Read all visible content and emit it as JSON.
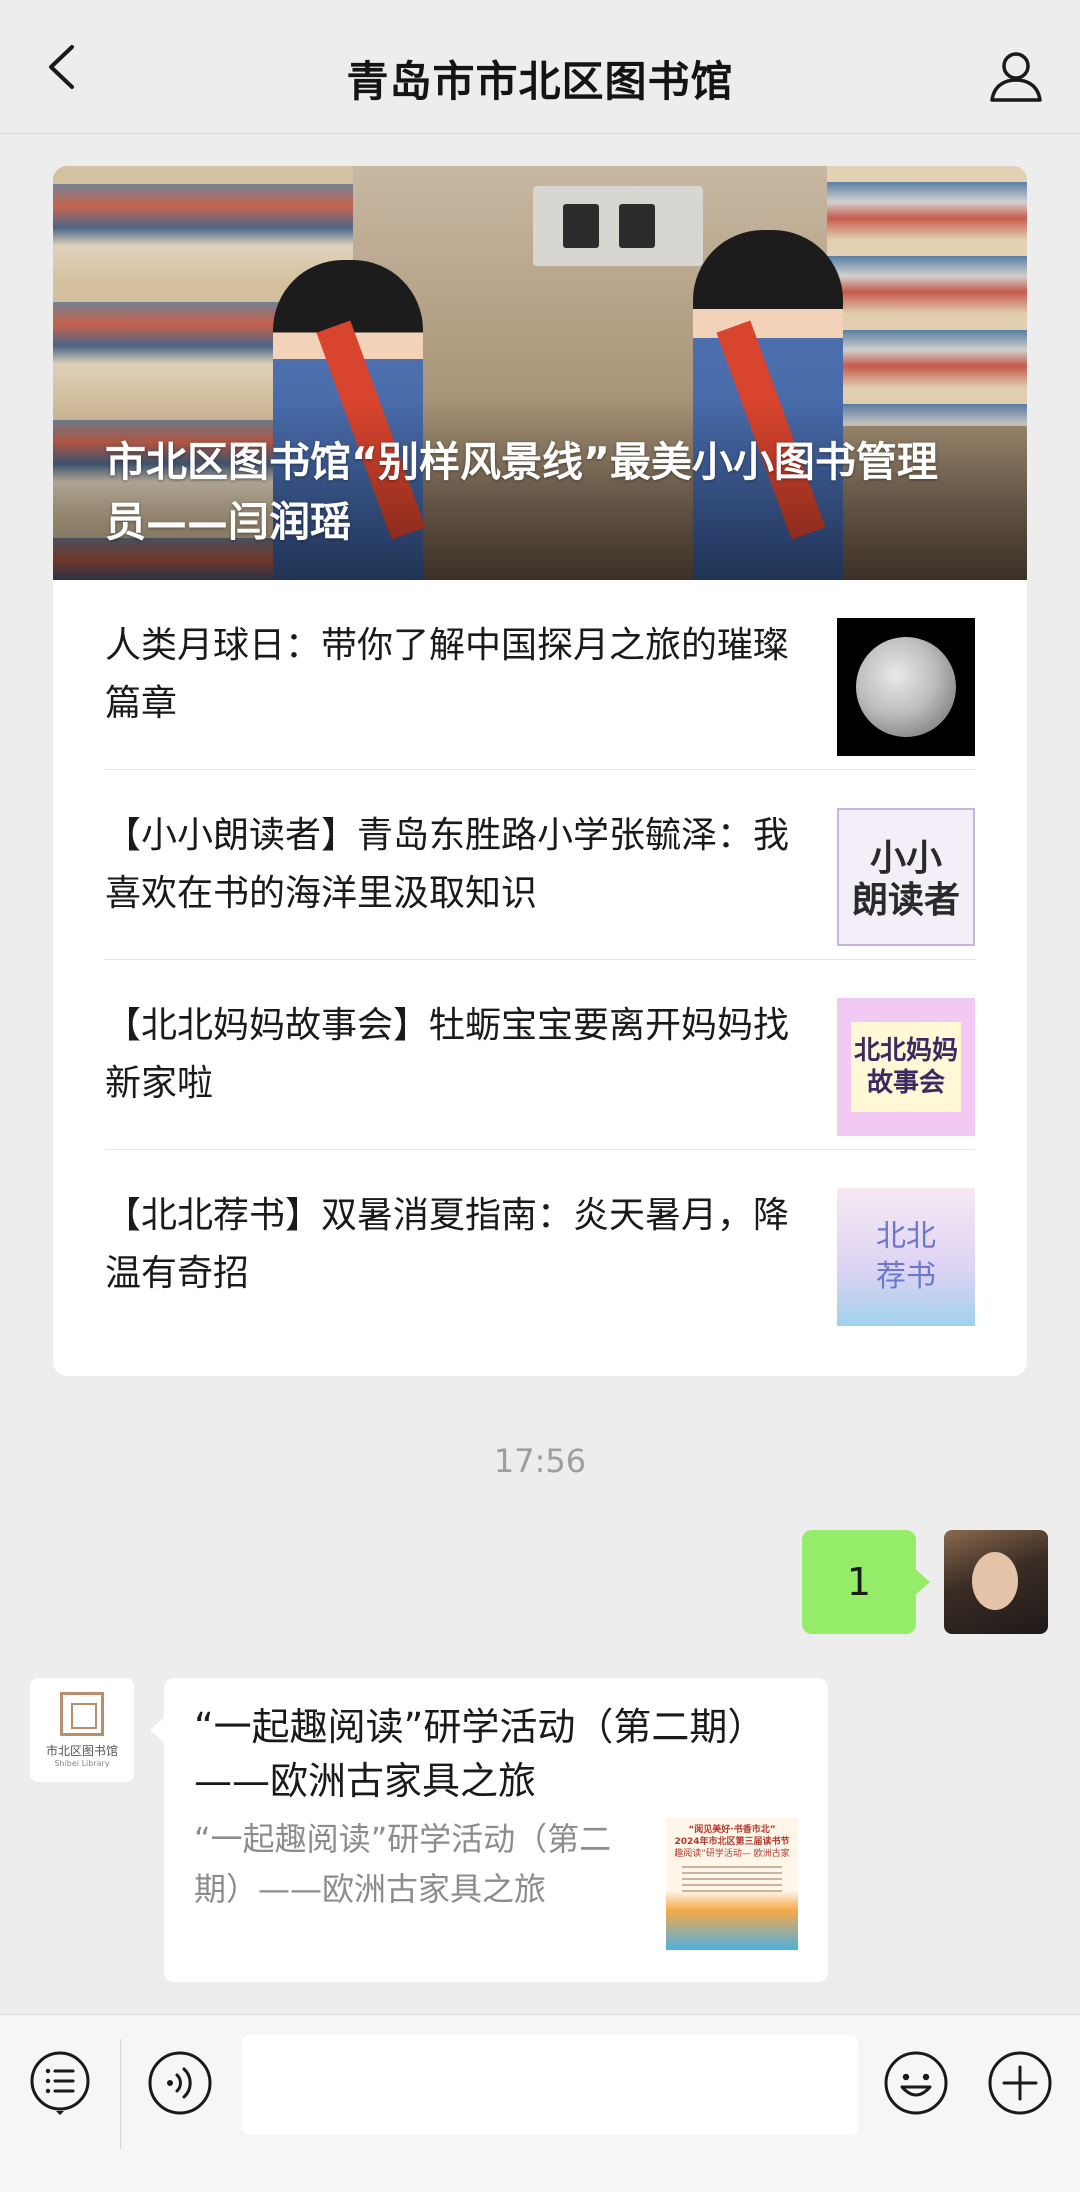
{
  "header": {
    "title": "青岛市市北区图书馆"
  },
  "article_card": {
    "hero_title": "市北区图书馆“别样风景线”最美小小图书管理员——闫润瑶",
    "items": [
      {
        "title": "人类月球日：带你了解中国探月之旅的璀璨篇章",
        "thumb": "moon"
      },
      {
        "title": "【小小朗读者】青岛东胜路小学张毓泽：我喜欢在书的海洋里汲取知识",
        "thumb_text": "小小\n朗读者"
      },
      {
        "title": "【北北妈妈故事会】牡蛎宝宝要离开妈妈找新家啦",
        "thumb_text": "北北妈妈\n故事会"
      },
      {
        "title": "【北北荐书】双暑消夏指南：炎天暑月，降温有奇招",
        "thumb_text": "北北\n荐书"
      }
    ]
  },
  "chat": {
    "timestamp": "17:56",
    "sent_message": "1",
    "library_avatar_text": "市北区图书馆",
    "library_avatar_en": "Shibei Library",
    "link_card": {
      "title": "“一起趣阅读”研学活动（第二期）——欧洲古家具之旅",
      "description": "“一起趣阅读”研学活动（第二期）——欧洲古家具之旅",
      "thumb_line1": "“阅见美好·书香市北”",
      "thumb_line2": "2024年市北区第三届读书节",
      "thumb_line3": "趣阅读”研学活动— 欧洲古家"
    }
  },
  "colors": {
    "background": "#ededed",
    "sent_bubble": "#95ec69",
    "timestamp": "#9e9e9e"
  },
  "icons": {
    "back": "chevron-left-icon",
    "profile": "user-icon",
    "menu": "list-menu-icon",
    "voice": "voice-icon",
    "emoji": "emoji-icon",
    "add": "plus-icon"
  }
}
